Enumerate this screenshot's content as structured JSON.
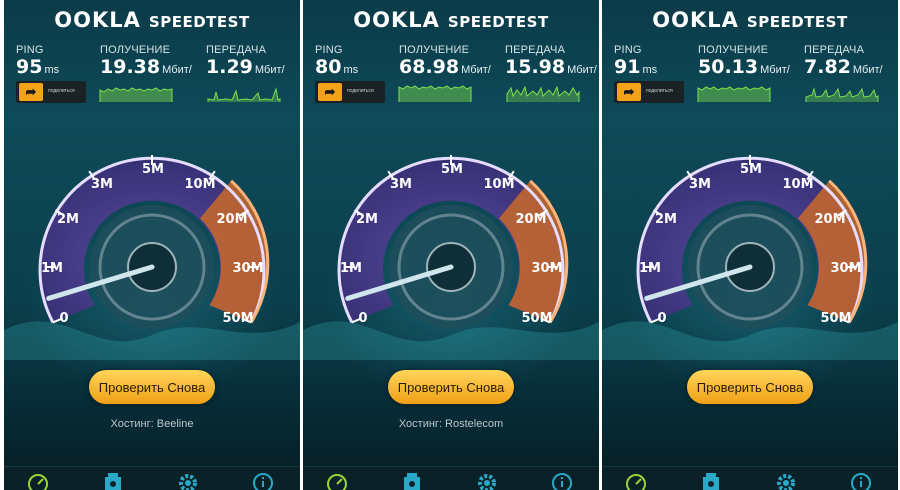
{
  "panels": [
    {
      "logo": "OOKLA",
      "app_name": "SPEEDTEST",
      "ping_label": "PING",
      "ping_value": "95",
      "ping_unit": "ms",
      "download_label": "ПОЛУЧЕНИЕ",
      "download_value": "19.38",
      "download_unit": "Мбит/",
      "upload_label": "ПЕРЕДАЧА",
      "upload_value": "1.29",
      "upload_unit": "Мбит/",
      "share_text": "поделиться",
      "gauge_ticks": [
        "0",
        "1M",
        "2M",
        "3M",
        "5M",
        "10M",
        "20M",
        "30M",
        "50M"
      ],
      "needle_speed_mbps": 0.2,
      "retest_label": "Проверить Снова",
      "hosting_text": "Хостинг: Beeline"
    },
    {
      "logo": "OOKLA",
      "app_name": "SPEEDTEST",
      "ping_label": "PING",
      "ping_value": "80",
      "ping_unit": "ms",
      "download_label": "ПОЛУЧЕНИЕ",
      "download_value": "68.98",
      "download_unit": "Мбит/",
      "upload_label": "ПЕРЕДАЧА",
      "upload_value": "15.98",
      "upload_unit": "Мбит/",
      "share_text": "поделиться",
      "gauge_ticks": [
        "0",
        "1M",
        "2M",
        "3M",
        "5M",
        "10M",
        "20M",
        "30M",
        "50M"
      ],
      "needle_speed_mbps": 0.2,
      "retest_label": "Проверить Снова",
      "hosting_text": "Хостинг: Rostelecom"
    },
    {
      "logo": "OOKLA",
      "app_name": "SPEEDTEST",
      "ping_label": "PING",
      "ping_value": "91",
      "ping_unit": "ms",
      "download_label": "ПОЛУЧЕНИЕ",
      "download_value": "50.13",
      "download_unit": "Мбит/",
      "upload_label": "ПЕРЕДАЧА",
      "upload_value": "7.82",
      "upload_unit": "Мбит/",
      "share_text": "поделиться",
      "gauge_ticks": [
        "0",
        "1M",
        "2M",
        "3M",
        "5M",
        "10M",
        "20M",
        "30M",
        "50M"
      ],
      "needle_speed_mbps": 0.2,
      "retest_label": "Проверить Снова",
      "hosting_text": ""
    }
  ],
  "tabs": [
    {
      "icon": "speedometer-icon"
    },
    {
      "icon": "results-icon"
    },
    {
      "icon": "gear-icon"
    },
    {
      "icon": "info-icon"
    }
  ],
  "colors": {
    "accent": "#f2a31b",
    "gauge_purple": "#6a4fb8",
    "gauge_orange": "#e0782a",
    "sparkline": "#7ee04a",
    "background": "#0e4a58"
  }
}
